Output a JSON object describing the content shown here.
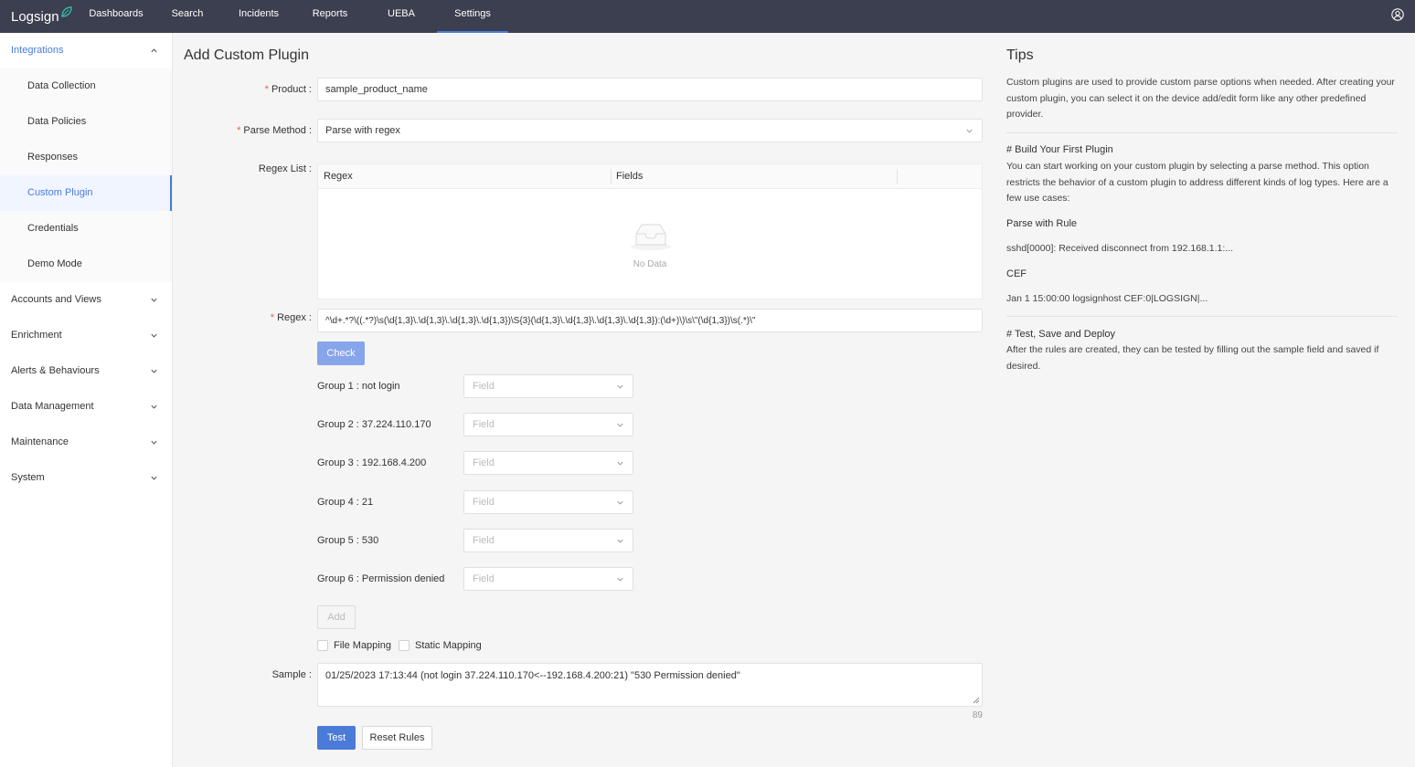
{
  "brand": {
    "name": "Logsign"
  },
  "nav": {
    "items": [
      {
        "label": "Dashboards"
      },
      {
        "label": "Search"
      },
      {
        "label": "Incidents"
      },
      {
        "label": "Reports"
      },
      {
        "label": "UEBA"
      },
      {
        "label": "Settings",
        "active": true
      }
    ],
    "accent": "#4a7bd8",
    "bg": "#3b3f4f"
  },
  "sidebar": {
    "open_group": "Integrations",
    "items": [
      {
        "label": "Data Collection"
      },
      {
        "label": "Data Policies"
      },
      {
        "label": "Responses"
      },
      {
        "label": "Custom Plugin",
        "active": true
      },
      {
        "label": "Credentials"
      },
      {
        "label": "Demo Mode"
      }
    ],
    "groups": [
      {
        "label": "Accounts and Views"
      },
      {
        "label": "Enrichment"
      },
      {
        "label": "Alerts & Behaviours"
      },
      {
        "label": "Data Management"
      },
      {
        "label": "Maintenance"
      },
      {
        "label": "System"
      }
    ]
  },
  "form": {
    "title": "Add Custom Plugin",
    "product": {
      "required_mark": "*",
      "label": "Product :",
      "value": "sample_product_name"
    },
    "parse_method": {
      "required_mark": "*",
      "label": "Parse Method :",
      "value": "Parse with regex"
    },
    "regex_list": {
      "label": "Regex List :",
      "columns": [
        "Regex",
        "Fields"
      ],
      "empty_text": "No Data"
    },
    "regex": {
      "required_mark": "*",
      "label": "Regex :",
      "value": "^\\d+.*?\\((.*?)\\s(\\d{1,3}\\.\\d{1,3}\\.\\d{1,3}\\.\\d{1,3})\\S{3}(\\d{1,3}\\.\\d{1,3}\\.\\d{1,3}\\.\\d{1,3}):(\\d+)\\)\\s\\\"(\\d{1,3})\\s(.*)\\\""
    },
    "check_button": "Check",
    "groups": [
      {
        "label": "Group 1 : not login",
        "placeholder": "Field"
      },
      {
        "label": "Group 2 : 37.224.110.170",
        "placeholder": "Field"
      },
      {
        "label": "Group 3 : 192.168.4.200",
        "placeholder": "Field"
      },
      {
        "label": "Group 4 : 21",
        "placeholder": "Field"
      },
      {
        "label": "Group 5 : 530",
        "placeholder": "Field"
      },
      {
        "label": "Group 6 : Permission denied",
        "placeholder": "Field"
      }
    ],
    "add_button": "Add",
    "file_mapping": {
      "label": "File Mapping",
      "checked": false
    },
    "static_mapping": {
      "label": "Static Mapping",
      "checked": false
    },
    "sample": {
      "label": "Sample :",
      "value": "01/25/2023 17:13:44 (not login 37.224.110.170<--192.168.4.200:21) \"530 Permission denied\"",
      "count": "89"
    },
    "test_button": "Test",
    "reset_button": "Reset Rules"
  },
  "tips": {
    "title": "Tips",
    "intro": "Custom plugins are used to provide custom parse options when needed. After creating your custom plugin, you can select it on the device add/edit form like any other predefined provider.",
    "build_heading": "# Build Your First Plugin",
    "build_text": "You can start working on your custom plugin by selecting a parse method. This option restricts the behavior of a custom plugin to address different kinds of log types. Here are a few use cases:",
    "rule_heading": "Parse with Rule",
    "rule_example": "sshd[0000]: Received disconnect from 192.168.1.1:...",
    "cef_heading": "CEF",
    "cef_example": "Jan 1 15:00:00 logsignhost CEF:0|LOGSIGN|...",
    "deploy_heading": "# Test, Save and Deploy",
    "deploy_text": "After the rules are created, they can be tested by filling out the sample field and saved if desired."
  }
}
